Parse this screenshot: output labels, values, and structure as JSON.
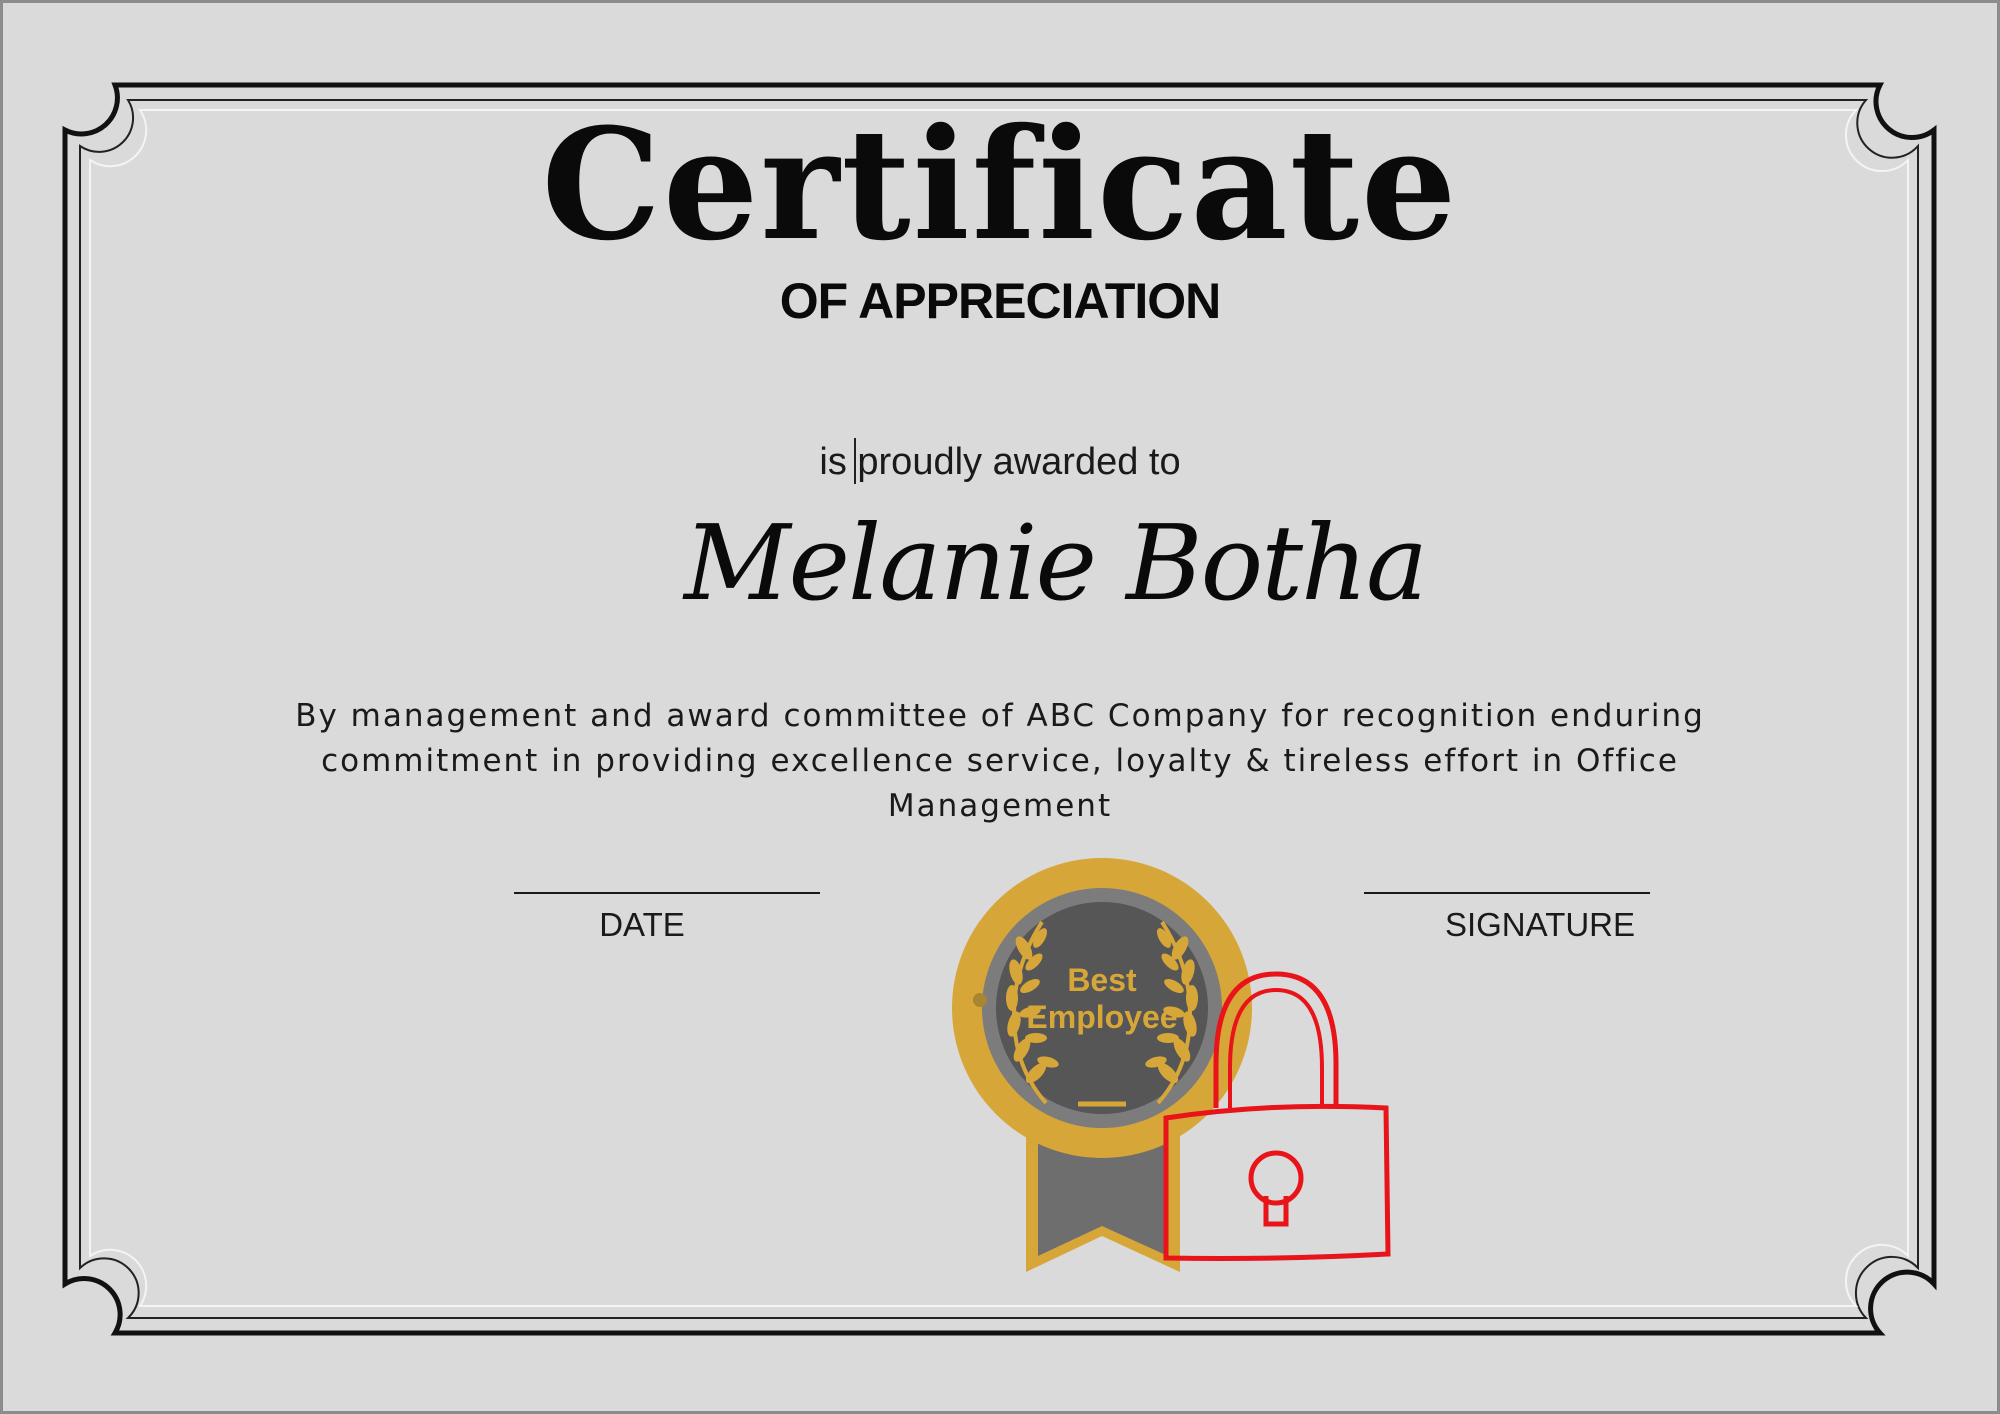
{
  "certificate": {
    "title": "Certificate",
    "subtitle": "OF APPRECIATION",
    "awarded_text": "is proudly awarded to",
    "recipient": "Melanie Botha",
    "description": "By management and award committee of ABC Company for recognition enduring commitment in providing excellence service, loyalty & tireless effort in Office Management",
    "date_label": "DATE",
    "signature_label": "SIGNATURE",
    "badge": {
      "line1": "Best",
      "line2": "Employee"
    }
  },
  "icons": {
    "badge": "award-medal-icon",
    "lock": "padlock-icon"
  },
  "colors": {
    "page_background": "#dadada",
    "border": "#111111",
    "badge_gold": "#d7a638",
    "badge_grey": "#5a5a5a",
    "lock_red": "#e8141a"
  }
}
